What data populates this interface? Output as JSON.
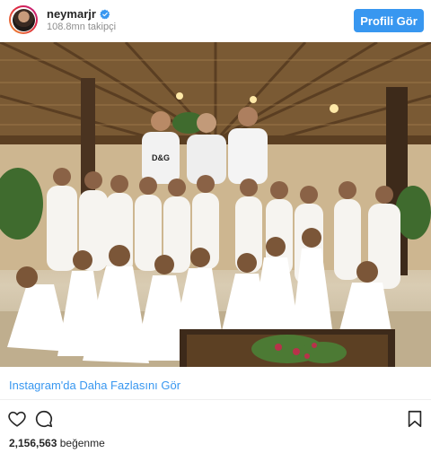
{
  "post": {
    "username": "neymarjr",
    "verified": true,
    "followers": "108.8mn takipçi",
    "profile_button_label": "Profili Gör",
    "more_link": "Instagram'da Daha Fazlasını Gör",
    "likes_count": "2,156,563",
    "likes_suffix": "beğenme"
  },
  "photo": {
    "shirt_text": "D&G"
  },
  "icons": {
    "verified": "verified-badge-icon",
    "like": "heart-icon",
    "comment": "comment-bubble-icon",
    "save": "bookmark-icon"
  },
  "colors": {
    "accent": "#3897f0",
    "text": "#262626",
    "muted": "#8e8e8e",
    "divider": "#efefef"
  }
}
